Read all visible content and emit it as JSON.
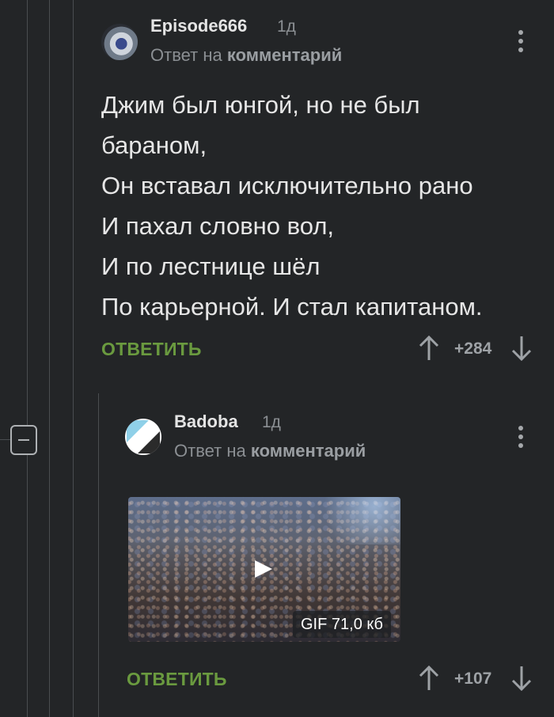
{
  "comments": [
    {
      "username": "Episode666",
      "time": "1д",
      "reply_prefix": "Ответ на",
      "reply_link": "комментарий",
      "text_lines": [
        "Джим был юнгой, но не был",
        "бараном,",
        "Он вставал исключительно рано",
        "И пахал словно вол,",
        "И по лестнице шёл",
        "По карьерной. И стал капитаном."
      ],
      "reply_label": "ОТВЕТИТЬ",
      "score": "+284"
    },
    {
      "username": "Badoba",
      "time": "1д",
      "reply_prefix": "Ответ на",
      "reply_link": "комментарий",
      "gif_label": "GIF 71,0 кб",
      "reply_label": "ОТВЕТИТЬ",
      "score": "+107"
    }
  ],
  "colors": {
    "background": "#232527",
    "reply_green": "#6a9a3f",
    "muted_text": "#8b8f93"
  },
  "icons": {
    "menu": "more-vertical-icon",
    "upvote": "arrow-up-icon",
    "downvote": "arrow-down-icon",
    "collapse": "minus-square-icon",
    "play": "play-icon"
  }
}
